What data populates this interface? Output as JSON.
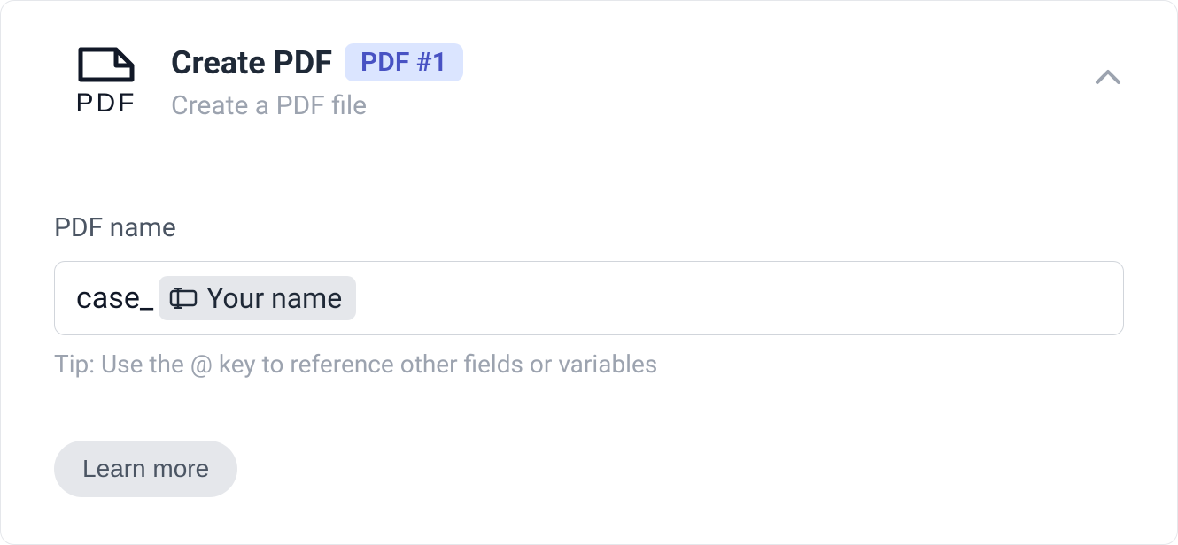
{
  "header": {
    "title": "Create PDF",
    "badge": "PDF #1",
    "subtitle": "Create a PDF file",
    "icon_label": "PDF"
  },
  "body": {
    "field_label": "PDF name",
    "input_prefix": "case_",
    "chip_label": "Your name",
    "tip": "Tip: Use the @ key to reference other fields or variables",
    "learn_more": "Learn more"
  }
}
